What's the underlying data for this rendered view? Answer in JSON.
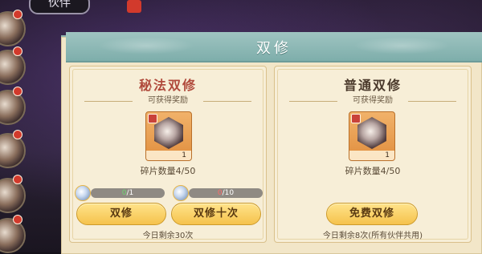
{
  "topbar": {
    "tab_label": "伙伴",
    "badge_label": ""
  },
  "modal": {
    "title": "双修",
    "left_panel": {
      "title": "秘法双修",
      "reward_label": "可获得奖励",
      "item_count": "1",
      "fragment_text": "碎片数量4/50",
      "costs": [
        {
          "have": "0",
          "need": "/1",
          "have_color": "#6fd66f"
        },
        {
          "have": "0",
          "need": "/10",
          "have_color": "#ff6a6a"
        }
      ],
      "buttons": [
        {
          "label": "双修"
        },
        {
          "label": "双修十次"
        }
      ],
      "remaining": "今日剩余30次"
    },
    "right_panel": {
      "title": "普通双修",
      "reward_label": "可获得奖励",
      "item_count": "1",
      "fragment_text": "碎片数量4/50",
      "button": {
        "label": "免费双修"
      },
      "remaining": "今日剩余8次(所有伙伴共用)"
    }
  },
  "colors": {
    "modal_bg": "#f2e6c8",
    "title_bar": "#7eaeab",
    "left_title": "#b04a3c",
    "button": "#f5c24c",
    "item_bg": "#e08e3e"
  }
}
